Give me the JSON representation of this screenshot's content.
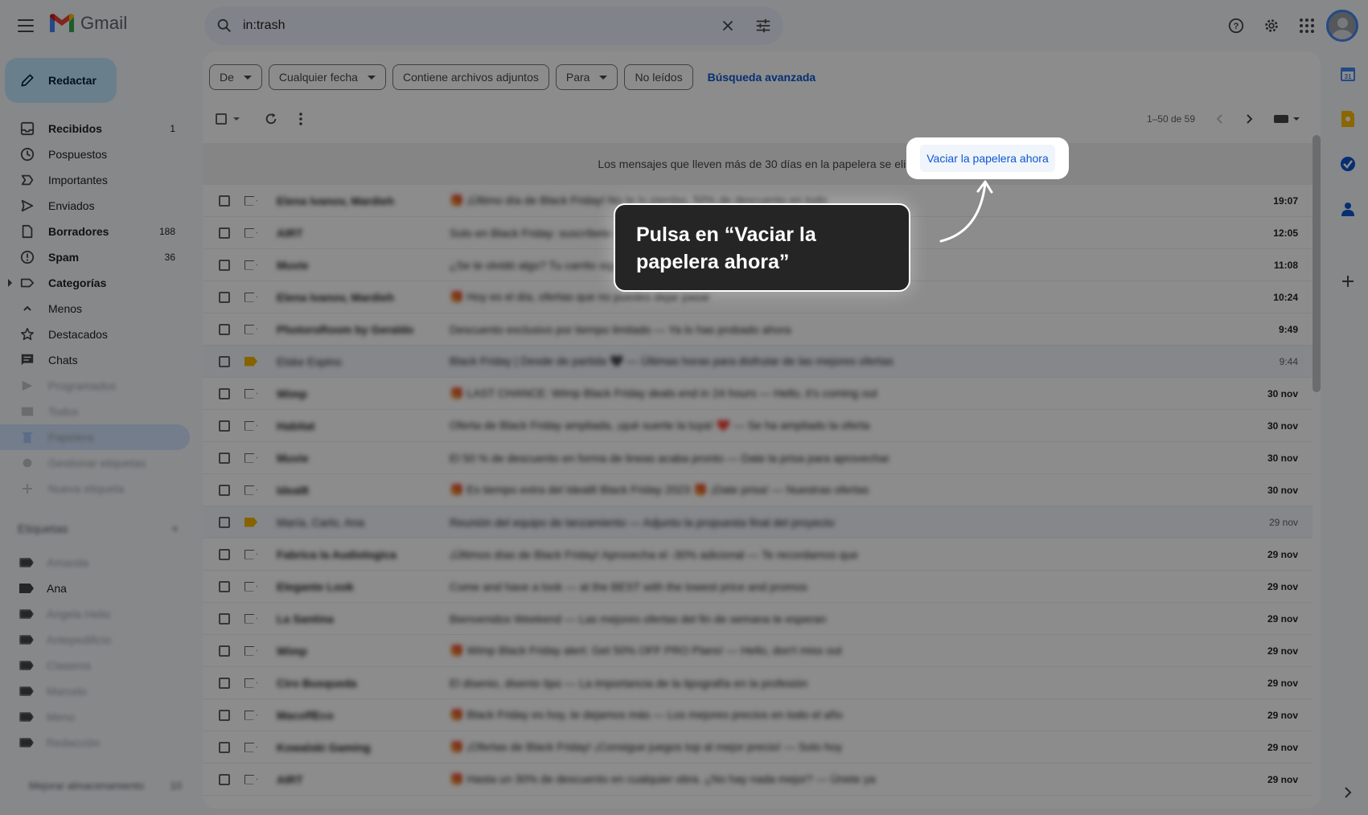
{
  "app": {
    "name": "Gmail"
  },
  "search": {
    "query": "in:trash"
  },
  "compose": {
    "label": "Redactar"
  },
  "nav": [
    {
      "label": "Recibidos",
      "count": "1",
      "icon": "inbox-icon",
      "bold": true
    },
    {
      "label": "Pospuestos",
      "count": "",
      "icon": "clock-icon"
    },
    {
      "label": "Importantes",
      "count": "",
      "icon": "important-icon"
    },
    {
      "label": "Enviados",
      "count": "",
      "icon": "send-icon"
    },
    {
      "label": "Borradores",
      "count": "188",
      "icon": "draft-icon",
      "bold": true
    },
    {
      "label": "Spam",
      "count": "36",
      "icon": "spam-icon",
      "bold": true
    },
    {
      "label": "Categorías",
      "count": "",
      "icon": "label-icon",
      "bold": true
    },
    {
      "label": "Menos",
      "count": "",
      "icon": "chevron-up-icon"
    },
    {
      "label": "Destacados",
      "count": "",
      "icon": "star-icon"
    },
    {
      "label": "Chats",
      "count": "",
      "icon": "chat-icon"
    },
    {
      "label": "Programados",
      "count": "",
      "icon": "scheduled-icon"
    },
    {
      "label": "Todos",
      "count": "",
      "icon": "mail-icon"
    },
    {
      "label": "Papelera",
      "count": "",
      "icon": "trash-icon"
    },
    {
      "label": "Gestionar etiquetas",
      "count": "",
      "icon": "gear-icon"
    },
    {
      "label": "Nueva etiqueta",
      "count": "",
      "icon": "plus-icon"
    }
  ],
  "labels": {
    "heading": "Etiquetas",
    "items": [
      "Amanda",
      "Ana",
      "Angela Helio",
      "Antepedificio",
      "Claseros",
      "Marcelo",
      "Meno",
      "Redacción"
    ]
  },
  "upgrade": {
    "label": "Mejorar almacenamiento",
    "count": "10"
  },
  "filters": {
    "from": "De",
    "date": "Cualquier fecha",
    "attachments": "Contiene archivos adjuntos",
    "to": "Para",
    "unread": "No leídos",
    "advanced": "Búsqueda avanzada"
  },
  "pager": {
    "range": "1–50 de 59"
  },
  "banner": {
    "text": "Los mensajes que lleven más de 30 días en la papelera se eliminarán automáticamente.",
    "action": "Vaciar la papelera ahora"
  },
  "tutorial": {
    "callout": "Pulsa en “Vaciar la papelera ahora”"
  },
  "messages": [
    {
      "sender": "Elena Ivanov, Mardieh",
      "snippet": "🎁 ¡Último día de Black Friday! No te lo pierdas, 50% de descuento en todo",
      "date": "19:07",
      "starred": false,
      "read": false
    },
    {
      "sender": "AIRT",
      "snippet": "Solo en Black Friday: suscríbete con 50% de descuento — Últimas horas",
      "date": "12:05",
      "starred": false,
      "read": false
    },
    {
      "sender": "Muvie",
      "snippet": "¿Se te olvidó algo? Tu carrito sigue esperando por ti",
      "date": "11:08",
      "starred": false,
      "read": false
    },
    {
      "sender": "Elena Ivanov, Mardieh",
      "snippet": "🎁 Hoy es el día, ofertas que no puedes dejar pasar",
      "date": "10:24",
      "starred": false,
      "read": false
    },
    {
      "sender": "PhotoroRoom by Geraldo",
      "snippet": "Descuento exclusivo por tiempo limitado — Ya lo has probado ahora",
      "date": "9:49",
      "starred": false,
      "read": false
    },
    {
      "sender": "Elske Espino",
      "snippet": "Black Friday | Desde de partida 🖤 — Últimas horas para disfrutar de las mejores ofertas",
      "date": "9:44",
      "starred": true,
      "read": true
    },
    {
      "sender": "Wimp",
      "snippet": "🎁 LAST CHANCE: Wimp Black Friday deals end in 24 hours — Hello, it's coming out",
      "date": "30 nov",
      "starred": false,
      "read": false
    },
    {
      "sender": "Habitat",
      "snippet": "Oferta de Black Friday ampliada, ¡qué suerte la tuya! ❤️ — Se ha ampliado la oferta",
      "date": "30 nov",
      "starred": false,
      "read": false
    },
    {
      "sender": "Muvie",
      "snippet": "El 50 % de descuento en forma de lineas acaba pronto — Date la prisa para aprovechar",
      "date": "30 nov",
      "starred": false,
      "read": false
    },
    {
      "sender": "Ideal8",
      "snippet": "🎁 Es tiempo extra del Ideal8 Black Friday 2023 🎁 ¡Date prisa! — Nuestras ofertas",
      "date": "30 nov",
      "starred": false,
      "read": false
    },
    {
      "sender": "María, Carlo, Ana",
      "snippet": "Reunión del equipo de lanzamiento — Adjunto la propuesta final del proyecto",
      "date": "29 nov",
      "starred": true,
      "read": true
    },
    {
      "sender": "Fabrica la Audiologica",
      "snippet": "¡Últimos días de Black Friday! Aprovecha el -30% adicional — Te recordamos que",
      "date": "29 nov",
      "starred": false,
      "read": false
    },
    {
      "sender": "Elegante Look",
      "snippet": "Come and have a look — at the BEST with the lowest price and promos",
      "date": "29 nov",
      "starred": false,
      "read": false
    },
    {
      "sender": "La Santina",
      "snippet": "Bienvenidos Weekend — Las mejores ofertas del fin de semana te esperan",
      "date": "29 nov",
      "starred": false,
      "read": false
    },
    {
      "sender": "Wimp",
      "snippet": "🎁 Wimp Black Friday alert: Get 50% OFF PRO Plans! — Hello, don't miss out",
      "date": "29 nov",
      "starred": false,
      "read": false
    },
    {
      "sender": "Ciro Busqueda",
      "snippet": "El disenio, disenio tipo — La importancia de la tipografía en la profesión",
      "date": "29 nov",
      "starred": false,
      "read": false
    },
    {
      "sender": "MacoffEco",
      "snippet": "🎁 Black Friday es hoy, te dejamos más — Los mejores precios en todo el año",
      "date": "29 nov",
      "starred": false,
      "read": false
    },
    {
      "sender": "Kowalski Gaming",
      "snippet": "🎁 ¡Ofertas de Black Friday! ¡Consigue juegos top al mejor precio! — Solo hoy",
      "date": "29 nov",
      "starred": false,
      "read": false
    },
    {
      "sender": "AIRT",
      "snippet": "🎁 Hasta un 30% de descuento en cualquier obra. ¿No hay nada mejor? — Únete ya",
      "date": "29 nov",
      "starred": false,
      "read": false
    }
  ]
}
